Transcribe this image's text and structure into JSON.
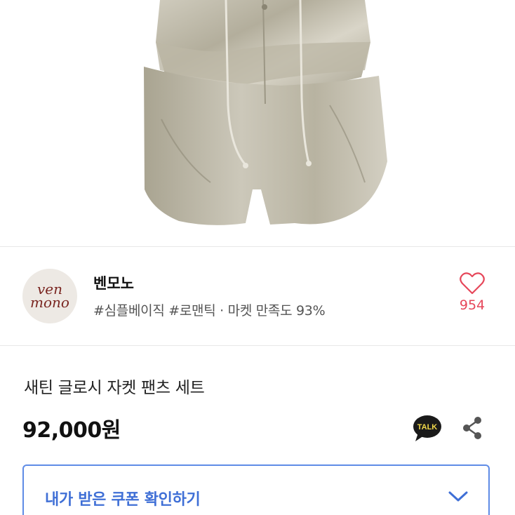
{
  "store": {
    "logo_line1": "ven",
    "logo_line2": "mono",
    "name": "벤모노",
    "tags": "#심플베이직 #로맨틱 · 마켓 만족도 93%",
    "like_count": "954"
  },
  "product": {
    "title": "새틴 글로시 자켓 팬츠 세트",
    "price": "92,000원"
  },
  "actions": {
    "talk_label": "TALK"
  },
  "coupon": {
    "label": "내가 받은 쿠폰 확인하기"
  },
  "colors": {
    "accent_blue": "#3f6fd6",
    "heart_red": "#e6475a",
    "logo_red": "#7a2621"
  }
}
